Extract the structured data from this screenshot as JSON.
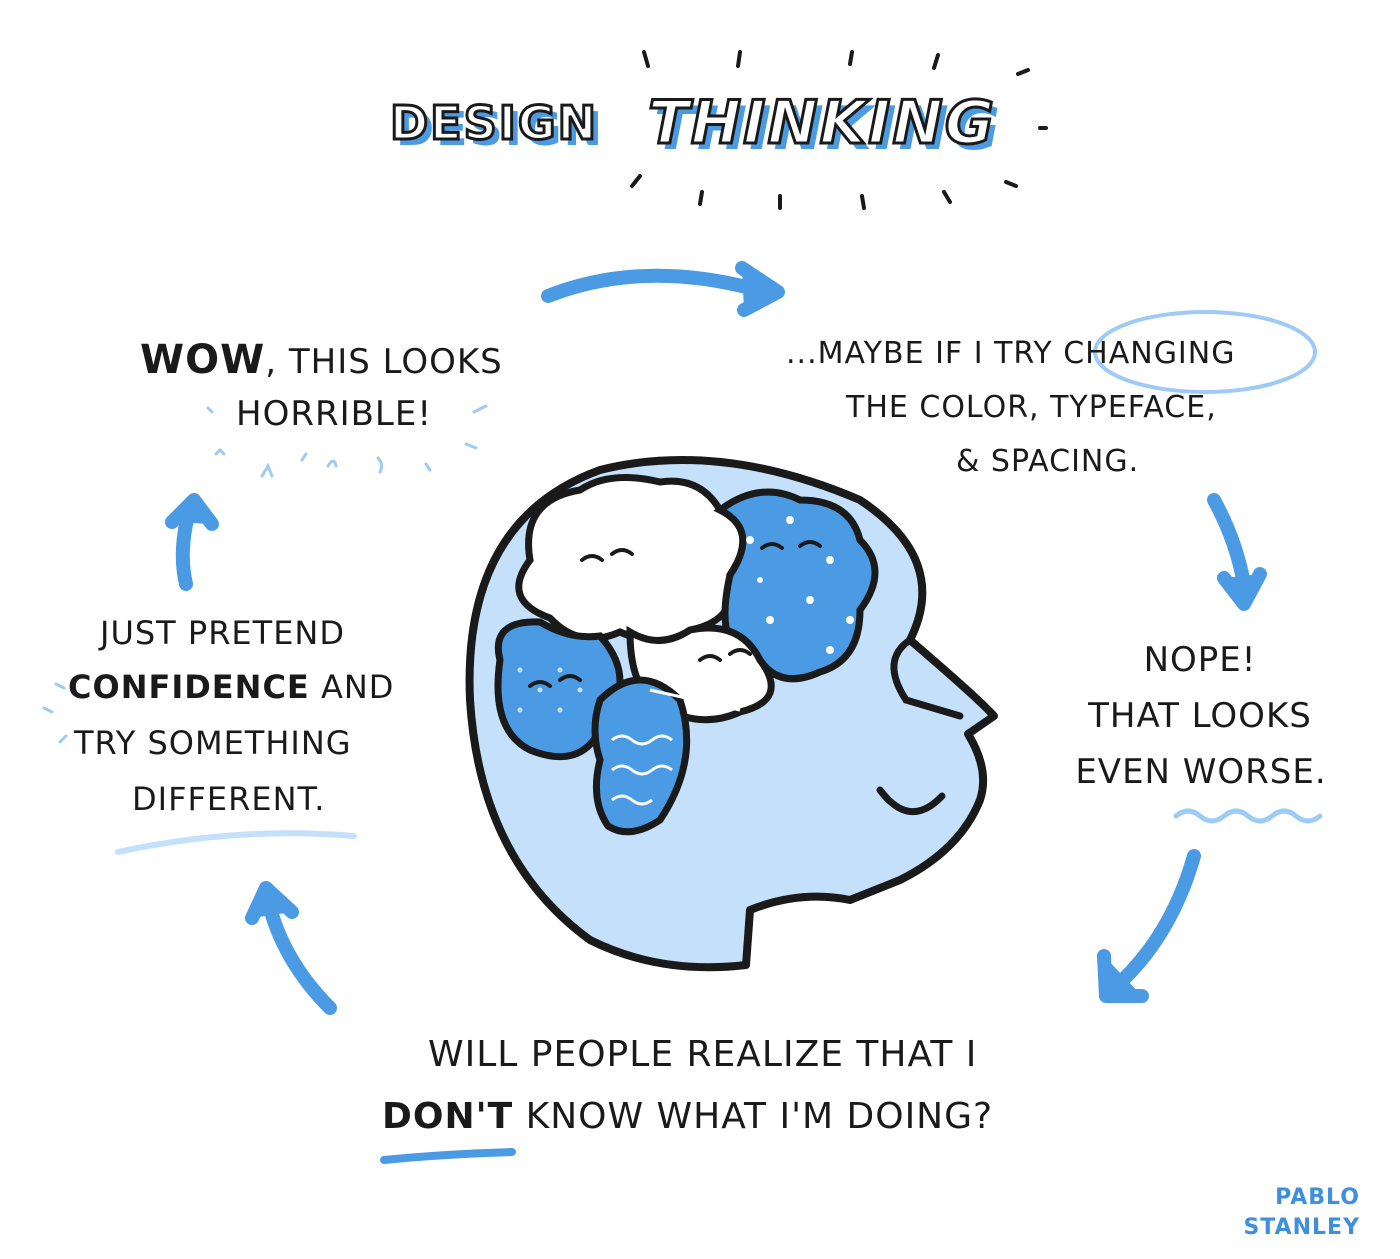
{
  "title": {
    "word1": "DESIGN",
    "word2": "THINKING"
  },
  "steps": {
    "wow": {
      "emphasis": "WOW",
      "line1_rest": ", THIS LOOKS",
      "line2": "HORRIBLE!"
    },
    "maybe": {
      "line1_pre": "...MAYBE IF I TRY ",
      "line1_circled": "CHANGING",
      "line2": "THE COLOR, TYPEFACE,",
      "line3": "& SPACING."
    },
    "nope": {
      "line1": "NOPE!",
      "line2": "THAT LOOKS",
      "line3": "EVEN WORSE."
    },
    "will": {
      "line1": "WILL PEOPLE REALIZE THAT I",
      "line2_emphasis": "DON'T",
      "line2_rest": " KNOW WHAT I'M DOING?"
    },
    "pretend": {
      "line1": "JUST PRETEND",
      "line2_emphasis": "CONFIDENCE",
      "line2_rest": " AND",
      "line3": "TRY SOMETHING",
      "line4": "DIFFERENT."
    }
  },
  "signature": {
    "line1": "PABLO",
    "line2": "STANLEY"
  },
  "icons": [
    "head-with-brain-illustration",
    "cycle-arrow"
  ],
  "colors": {
    "accent": "#4a9be3",
    "light_blue": "#c4e0fb",
    "ink": "#1a1a1a"
  }
}
